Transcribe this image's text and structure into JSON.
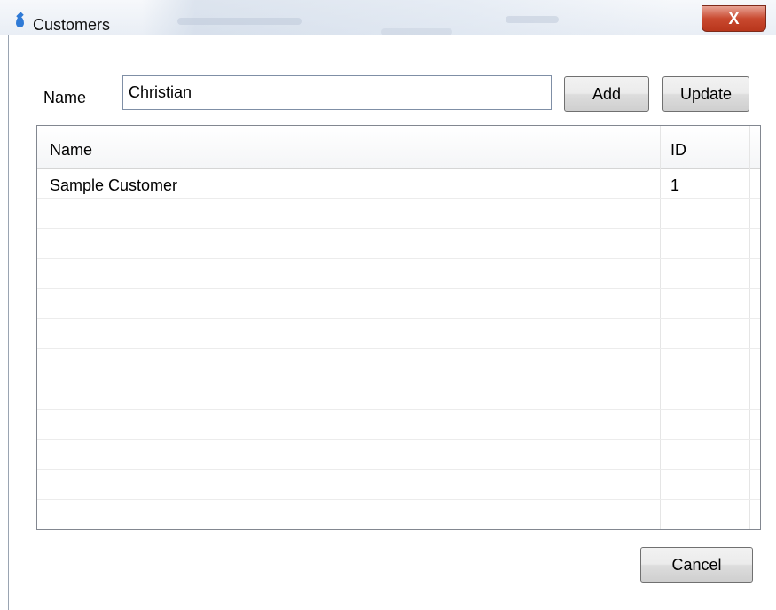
{
  "window": {
    "title": "Customers",
    "close_glyph": "X",
    "app_icon": "water-drop-icon"
  },
  "form": {
    "name_label": "Name",
    "name_value": "Christian",
    "add_label": "Add",
    "update_label": "Update",
    "cancel_label": "Cancel"
  },
  "table": {
    "columns": [
      "Name",
      "ID"
    ],
    "rows": [
      {
        "name": "Sample Customer",
        "id": "1"
      }
    ]
  },
  "colors": {
    "close_button": "#c9492f",
    "app_icon": "#2f7ad6"
  }
}
